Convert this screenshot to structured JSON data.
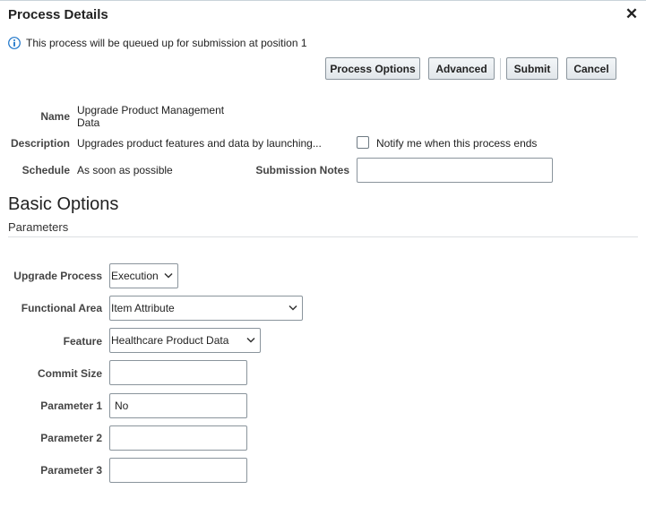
{
  "dialog": {
    "title": "Process Details",
    "close_glyph": "✕"
  },
  "info": {
    "icon": "info-icon",
    "message": "This process will be queued up for submission at position 1"
  },
  "buttons": {
    "process_options": "Process Options",
    "advanced": "Advanced",
    "submit": "Submit",
    "cancel": "Cancel"
  },
  "details": {
    "name_label": "Name",
    "name_value_line1": "Upgrade Product Management",
    "name_value_line2": "Data",
    "description_label": "Description",
    "description_value": "Upgrades product features and data by launching...",
    "schedule_label": "Schedule",
    "schedule_value": "As soon as possible",
    "notify_label": "Notify me when this process ends",
    "notify_checked": false,
    "submission_notes_label": "Submission Notes",
    "submission_notes_value": ""
  },
  "basic_options": {
    "title": "Basic Options",
    "subtitle": "Parameters"
  },
  "parameters": {
    "upgrade_process_label": "Upgrade Process",
    "upgrade_process_value": "Execution",
    "functional_area_label": "Functional Area",
    "functional_area_value": "Item Attribute",
    "feature_label": "Feature",
    "feature_value": "Healthcare Product Data",
    "commit_size_label": "Commit Size",
    "commit_size_value": "",
    "parameter1_label": "Parameter 1",
    "parameter1_value": "No",
    "parameter2_label": "Parameter 2",
    "parameter2_value": "",
    "parameter3_label": "Parameter 3",
    "parameter3_value": ""
  },
  "colors": {
    "info_icon": "#1a73c8",
    "button_border": "#8c969e"
  }
}
